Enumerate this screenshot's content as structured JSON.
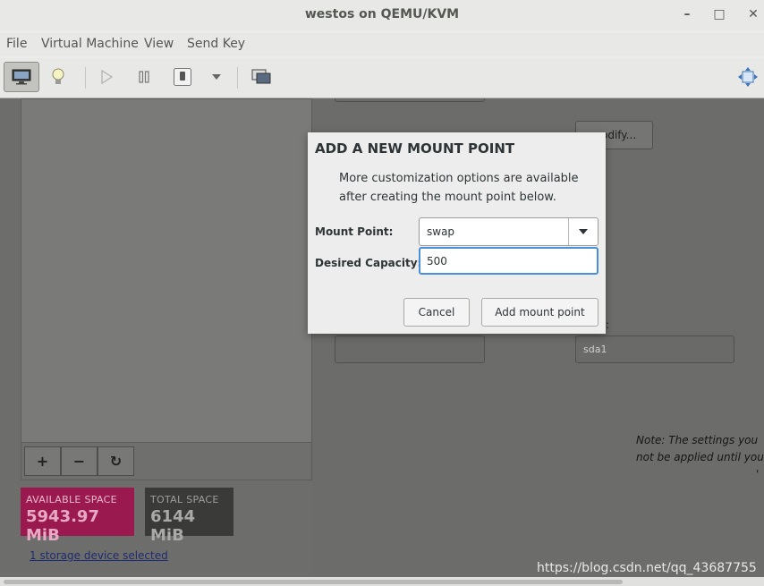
{
  "window": {
    "title": "westos on QEMU/KVM",
    "minimize": "–",
    "maximize": "□",
    "close": "✕"
  },
  "menu": [
    "File",
    "Virtual Machine",
    "View",
    "Send Key"
  ],
  "toolbar": {
    "icons": [
      "console-icon",
      "lightbulb-icon",
      "play-icon",
      "pause-icon",
      "shutdown-icon",
      "dropdown-icon",
      "snapshot-icon",
      "fullscreen-icon"
    ]
  },
  "background": {
    "modify_button": "odify...",
    "device_value": "sda1",
    "colon": ":",
    "note_line1": "Note:  The settings you",
    "note_line2": "not be applied until you",
    "note_line3": "'",
    "controls": {
      "add": "+",
      "remove": "−",
      "refresh": "↻"
    },
    "available": {
      "label": "AVAILABLE SPACE",
      "value": "5943.97 MiB",
      "color": "#9a1a4f"
    },
    "total": {
      "label": "TOTAL SPACE",
      "value": "6144 MiB",
      "color": "#3a3a39"
    },
    "storage_link": "1 storage device selected",
    "watermark": "https://blog.csdn.net/qq_43687755"
  },
  "dialog": {
    "title": "ADD A NEW MOUNT POINT",
    "description": "More customization options are available after creating the mount point below.",
    "mount_point_label": "Mount Point:",
    "mount_point_value": "swap",
    "capacity_label": "Desired Capacity:",
    "capacity_value": "500",
    "cancel": "Cancel",
    "add": "Add mount point"
  }
}
